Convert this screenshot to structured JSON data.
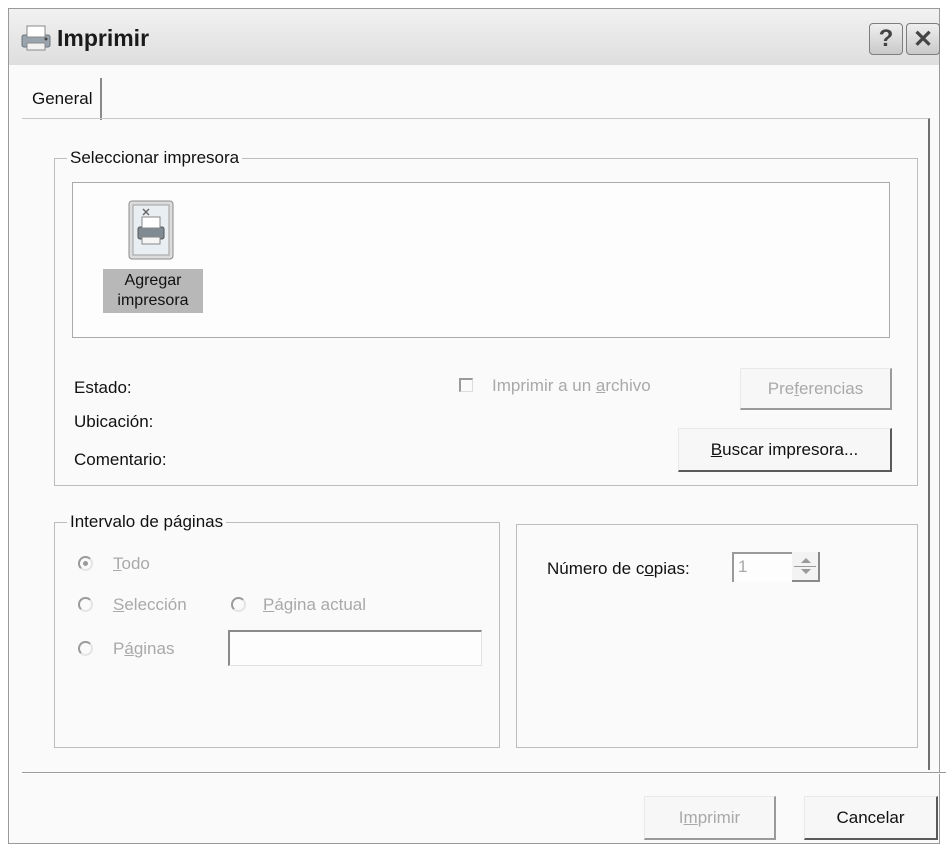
{
  "window": {
    "title": "Imprimir"
  },
  "titlebar_buttons": {
    "help": "?",
    "close": "✕"
  },
  "tabs": [
    {
      "label": "General",
      "active": true
    }
  ],
  "select_printer": {
    "legend": "Seleccionar impresora",
    "items": [
      {
        "label_line1": "Agregar",
        "label_line2": "impresora",
        "selected": true
      }
    ]
  },
  "printer_info": {
    "status_label": "Estado:",
    "location_label": "Ubicación:",
    "comment_label": "Comentario:",
    "print_to_file": {
      "pre": "Imprimir a un ",
      "u": "a",
      "post": "rchivo",
      "checked": false,
      "enabled": false
    },
    "preferences_button": {
      "pre": "Pre",
      "u": "f",
      "post": "erencias",
      "enabled": false
    },
    "find_printer_button": {
      "u": "B",
      "post": "uscar impresora..."
    }
  },
  "page_range": {
    "legend": "Intervalo de páginas",
    "all": {
      "u": "T",
      "post": "odo",
      "checked": true,
      "enabled": false
    },
    "selection": {
      "u": "S",
      "post": "elección",
      "enabled": false
    },
    "current_page": {
      "u": "P",
      "post": "ágina actual",
      "enabled": false
    },
    "pages": {
      "pre": "P",
      "u": "á",
      "post": "ginas",
      "value": "",
      "enabled": false
    }
  },
  "copies": {
    "label": {
      "pre": "Número de c",
      "u": "o",
      "post": "pias:"
    },
    "value": "1"
  },
  "footer": {
    "print_button": {
      "pre": "I",
      "u": "m",
      "post": "primir",
      "enabled": false
    },
    "cancel_button": "Cancelar"
  }
}
